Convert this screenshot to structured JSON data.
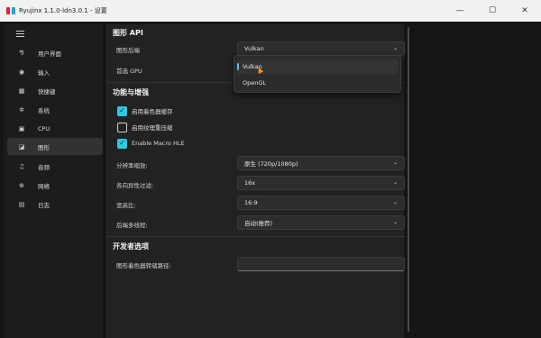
{
  "window": {
    "title": "Ryujinx 1.1.0-ldn3.0.1 - 设置",
    "minimize_glyph": "—",
    "maximize_glyph": "☐",
    "close_glyph": "✕"
  },
  "sidebar": {
    "items": [
      {
        "label": "用户界面",
        "icon": "user-interface-icon",
        "glyph": "⅋"
      },
      {
        "label": "输入",
        "icon": "gamepad-icon",
        "glyph": "◉"
      },
      {
        "label": "快捷键",
        "icon": "keyboard-icon",
        "glyph": "▦"
      },
      {
        "label": "系统",
        "icon": "gear-icon",
        "glyph": "✲"
      },
      {
        "label": "CPU",
        "icon": "chip-icon",
        "glyph": "▣"
      },
      {
        "label": "图形",
        "icon": "image-icon",
        "glyph": "◪"
      },
      {
        "label": "音频",
        "icon": "music-icon",
        "glyph": "♫"
      },
      {
        "label": "网络",
        "icon": "globe-icon",
        "glyph": "⊕"
      },
      {
        "label": "日志",
        "icon": "document-icon",
        "glyph": "▤"
      }
    ],
    "active_index": 5
  },
  "graphics_api": {
    "title": "图形 API",
    "backend_label": "图形后端",
    "backend_value": "Vulkan",
    "gpu_label": "首选 GPU",
    "dropdown_options": [
      "Vulkan",
      "OpenGL"
    ],
    "dropdown_selected": "Vulkan"
  },
  "features": {
    "title": "功能与增强",
    "checkboxes": [
      {
        "label": "启用着色器缓存",
        "checked": true
      },
      {
        "label": "启用纹理重压缩",
        "checked": false
      },
      {
        "label": "Enable Macro HLE",
        "checked": true
      }
    ],
    "resolution_label": "分辨率缩放:",
    "resolution_value": "原生 (720p/1080p)",
    "aniso_label": "各向异性过滤:",
    "aniso_value": "16x",
    "aspect_label": "宽高比:",
    "aspect_value": "16:9",
    "multithread_label": "后端多线程:",
    "multithread_value": "自动(推荐)"
  },
  "developer": {
    "title": "开发者选项",
    "shader_dump_label": "图形着色器转储路径:",
    "shader_dump_value": ""
  },
  "colors": {
    "accent": "#2ec8e4",
    "selection_marker": "#4cc2ff",
    "active_nav_bg": "#323232"
  }
}
